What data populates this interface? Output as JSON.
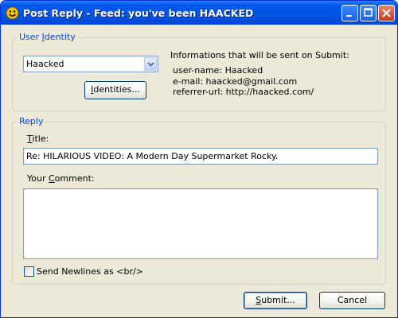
{
  "window": {
    "title": "Post Reply - Feed: you've been HAACKED"
  },
  "identity_group": {
    "legend_prefix": "User ",
    "legend_accel": "I",
    "legend_suffix": "dentity",
    "selected_identity": "Haacked",
    "identities_button": {
      "accel": "I",
      "rest": "dentities..."
    },
    "info_heading": "Informations that will be sent on Submit:",
    "info_lines": [
      "user-name: Haacked",
      "e-mail: haacked@gmail.com",
      "referrer-url: http://haacked.com/"
    ]
  },
  "reply_group": {
    "legend": "Reply",
    "title_label": {
      "accel": "T",
      "rest": "itle:"
    },
    "title_value": "Re: HILARIOUS VIDEO: A Modern Day Supermarket Rocky.",
    "comment_label": {
      "prefix": "Your ",
      "accel": "C",
      "rest": "omment:"
    },
    "comment_value": "",
    "newlines_label": "Send Newlines as <br/>",
    "newlines_checked": false
  },
  "buttons": {
    "submit": {
      "accel": "S",
      "rest": "ubmit..."
    },
    "cancel": "Cancel"
  },
  "colors": {
    "titlebar": "#0058ee",
    "dialog_bg": "#ece9d8",
    "legend_text": "#0046d5",
    "close_button": "#c23b1c"
  }
}
